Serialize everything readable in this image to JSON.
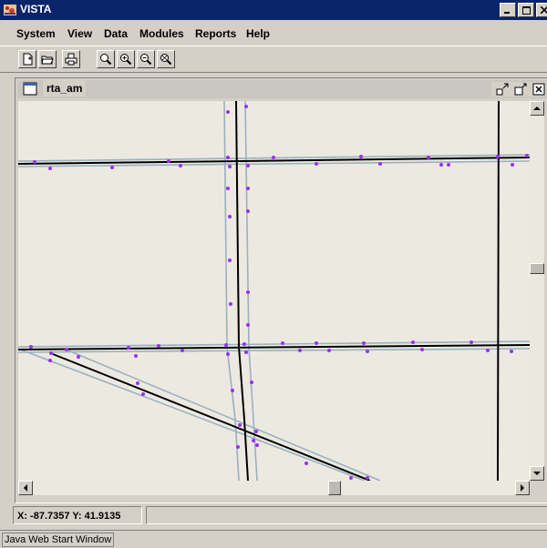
{
  "app": {
    "title": "VISTA"
  },
  "menu": [
    "System",
    "View",
    "Data",
    "Modules",
    "Reports",
    "Help"
  ],
  "toolbar": {
    "buttons": [
      "new-document-icon",
      "open-folder-icon",
      "print-icon",
      "zoom-icon",
      "zoom-in-icon",
      "zoom-out-icon",
      "zoom-extent-icon"
    ]
  },
  "internal_frame": {
    "title": "rta_am"
  },
  "status": {
    "coordinates": "X: -87.7357 Y: 41.9135"
  },
  "footer": {
    "label": "Java Web Start Window"
  },
  "colors": {
    "titlebar": "#0a246a",
    "map_background": "#eceae0",
    "road_line": "#000000",
    "road_buffer": "#9ab0c0",
    "stop_marker": "#9b2ff0"
  }
}
